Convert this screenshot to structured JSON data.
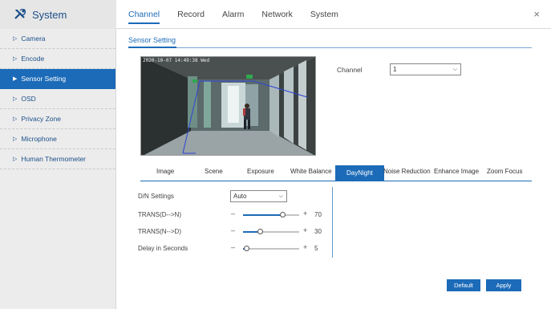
{
  "app": {
    "title": "System"
  },
  "main_tabs": [
    {
      "label": "Channel",
      "active": true
    },
    {
      "label": "Record",
      "active": false
    },
    {
      "label": "Alarm",
      "active": false
    },
    {
      "label": "Network",
      "active": false
    },
    {
      "label": "System",
      "active": false
    }
  ],
  "close_glyph": "×",
  "sidebar": {
    "items": [
      {
        "label": "Camera",
        "active": false
      },
      {
        "label": "Encode",
        "active": false
      },
      {
        "label": "Sensor Setting",
        "active": true
      },
      {
        "label": "OSD",
        "active": false
      },
      {
        "label": "Privacy Zone",
        "active": false
      },
      {
        "label": "Microphone",
        "active": false
      },
      {
        "label": "Human Thermometer",
        "active": false
      }
    ]
  },
  "section": {
    "title": "Sensor Setting"
  },
  "video": {
    "osd_text": "2020-10-07 14:49:38 Wed"
  },
  "channel": {
    "label": "Channel",
    "value": "1"
  },
  "sub_tabs": [
    {
      "label": "Image",
      "active": false
    },
    {
      "label": "Scene",
      "active": false
    },
    {
      "label": "Exposure",
      "active": false
    },
    {
      "label": "White Balance",
      "active": false
    },
    {
      "label": "DayNight",
      "active": true
    },
    {
      "label": "Noise Reduction",
      "active": false
    },
    {
      "label": "Enhance Image",
      "active": false
    },
    {
      "label": "Zoom Focus",
      "active": false
    }
  ],
  "daynight": {
    "dn_settings": {
      "label": "D/N Settings",
      "value": "Auto"
    },
    "trans_dn": {
      "label": "TRANS(D-->N)",
      "value": "70",
      "fraction": 0.7
    },
    "trans_nd": {
      "label": "TRANS(N-->D)",
      "value": "30",
      "fraction": 0.3
    },
    "delay": {
      "label": "Delay in Seconds",
      "value": "5",
      "fraction": 0.05
    }
  },
  "controls": {
    "minus": "–",
    "plus": "+"
  },
  "buttons": {
    "default": "Default",
    "apply": "Apply"
  },
  "colors": {
    "accent": "#1c6bb8",
    "sidebar_bg": "#ececec",
    "sidebar_text": "#1b4f8a"
  },
  "icons": {
    "brand": "tools-icon",
    "close": "close-icon",
    "sidebar_arrow": "triangle-right-icon",
    "dropdown": "chevron-down-icon"
  }
}
